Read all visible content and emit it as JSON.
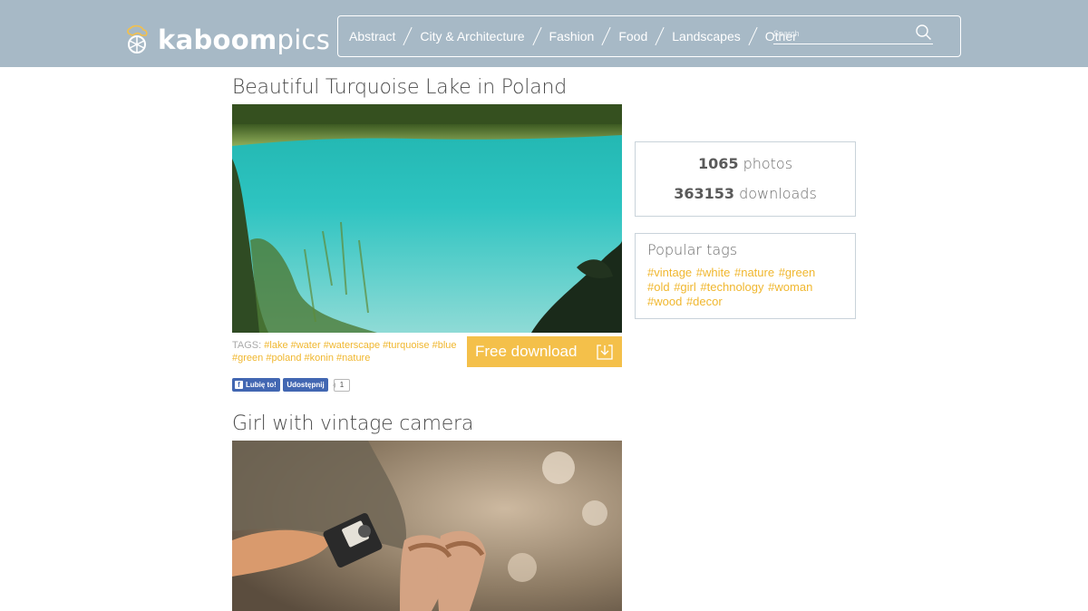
{
  "header": {
    "logo": {
      "text_bold": "kaboom",
      "text_light": "pics"
    },
    "nav": [
      "Abstract",
      "City & Architecture",
      "Fashion",
      "Food",
      "Landscapes",
      "Other"
    ],
    "search": {
      "placeholder": "Search",
      "icon": "search-icon"
    }
  },
  "posts": [
    {
      "title": "Beautiful Turquoise Lake in Poland",
      "tags_label": "TAGS:",
      "tags": [
        "#lake",
        "#water",
        "#waterscape",
        "#turquoise",
        "#blue",
        "#green",
        "#poland",
        "#konin",
        "#nature"
      ],
      "download_label": "Free download",
      "download_icon": "download-icon",
      "facebook": {
        "like_label": "Lubię to!",
        "share_label": "Udostępnij",
        "count": "1"
      }
    },
    {
      "title": "Girl with vintage camera"
    }
  ],
  "sidebar": {
    "stats": {
      "photos_count": "1065",
      "photos_label": "photos",
      "downloads_count": "363153",
      "downloads_label": "downloads"
    },
    "popular_tags": {
      "title": "Popular tags",
      "tags": [
        "#vintage",
        "#white",
        "#nature",
        "#green",
        "#old",
        "#girl",
        "#technology",
        "#woman",
        "#wood",
        "#decor"
      ]
    }
  },
  "colors": {
    "header_bg": "#a7b9c6",
    "accent": "#f4c04a",
    "tag": "#f0b72f",
    "facebook": "#4267b2"
  }
}
